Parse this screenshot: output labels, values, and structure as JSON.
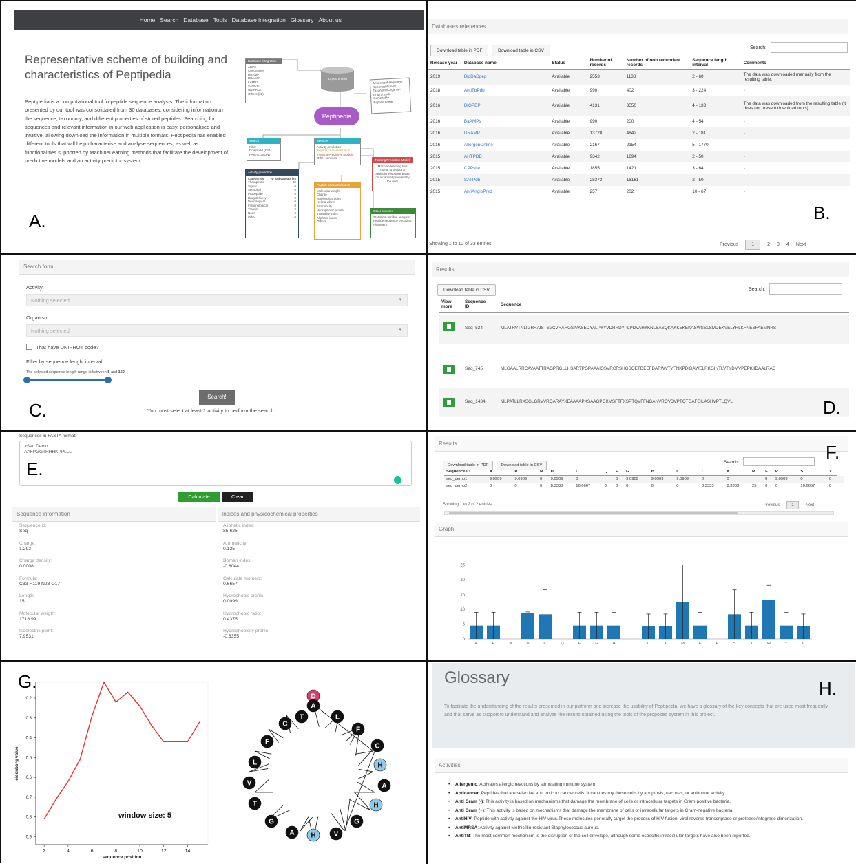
{
  "labels": {
    "a": "A.",
    "b": "B.",
    "c": "C.",
    "d": "D.",
    "e": "E.",
    "f": "F.",
    "g": "G.",
    "h": "H."
  },
  "panel_a": {
    "nav": [
      "Home",
      "Search",
      "Database",
      "Tools",
      "Database integration",
      "Glossary",
      "About us"
    ],
    "title": "Representative scheme of building and characteristics of Peptipedia",
    "text": "Peptipedia is a computational tool forpeptide sequence analysis. The information presented by our tool was consolidated from 30 databases, considering informationon the sequence, taxonomy, and different properties of stored peptides. Searching for sequences and relevant information in our web application is easy, personalised and intuitive, allowing download the information in multiple formats. Peptipedia has enabled different tools that will help characterise and analyse sequences, as well as functionalities supported by MachineLearning methods that facilitate the development of predictive models and an activity predictor system.",
    "diagram": {
      "db_integration": "Database integration",
      "db_list": [
        "ADP3",
        "ConoServer",
        "DRAMP",
        "DBAASP",
        "LAMP2",
        "SATPdb",
        "UNIPROT",
        "Others (22)"
      ],
      "center": "Peptipedia",
      "storage": "33,000 entries",
      "records": [
        "Amino acid sequence",
        "Reported Activity",
        "Taxonomy/Organism",
        "Uniprot code",
        "Genic table",
        "Peptide name"
      ],
      "search": {
        "title": "Search",
        "items": [
          "Filter",
          "Download (CSV, FASTA, JSON)"
        ]
      },
      "services": {
        "title": "Services",
        "items": [
          "Activity prediction",
          "Peptide characterization",
          "Training Predictive Models",
          "Other services"
        ]
      },
      "training": {
        "title": "Training Prediction Model",
        "text": "Machine learning tool useful to predict a particular response based on a dataset provided by the user"
      },
      "activity": {
        "title": "Activity prediction",
        "cols": [
          "Categories",
          "N° subcategories"
        ],
        "rows": [
          [
            "Therapeutic",
            "32"
          ],
          [
            "Signal",
            "0"
          ],
          [
            "Sensorial",
            "0"
          ],
          [
            "Propeptide",
            "0"
          ],
          [
            "Drug delivery",
            "0"
          ],
          [
            "Neurological",
            "0"
          ],
          [
            "Immunological",
            "0"
          ],
          [
            "Transit",
            "0"
          ],
          [
            "None",
            "0"
          ],
          [
            "Other",
            "0"
          ]
        ]
      },
      "characterization": {
        "title": "Peptide characterization",
        "items": [
          "Molecular weight",
          "Charge",
          "Isoelectrical point",
          "Helical wheel",
          "Aromaticity",
          "Hydrophobic profile",
          "Instability index",
          "Aliphatic index",
          "Others"
        ]
      },
      "other": {
        "title": "Other services",
        "items": [
          "Statistical residue analysis",
          "Peptide sequence encoding",
          "Alignment"
        ]
      }
    }
  },
  "panel_b": {
    "header": "Databases references",
    "btn_pdf": "Download table in PDF",
    "btn_csv": "Download table in CSV",
    "search_label": "Search:",
    "columns": [
      "Release year",
      "Database name",
      "Status",
      "Number of records",
      "Number of non redundant records",
      "Sequence length interval",
      "Comments"
    ],
    "rows": [
      [
        "2019",
        "BioDaDpep",
        "Available",
        "2553",
        "1138",
        "2 - 60",
        "The data was downloaded manually from the resulting table."
      ],
      [
        "2018",
        "AntiTbPdb",
        "Available",
        "990",
        "402",
        "3 - 224",
        "-"
      ],
      [
        "2016",
        "BIOPEP",
        "Available",
        "4131",
        "3550",
        "4 - 133",
        "The data was downloaded from the resulting table (it does not present download tools)"
      ],
      [
        "2016",
        "BaAMPs",
        "Available",
        "990",
        "200",
        "4 - 54",
        "-"
      ],
      [
        "2016",
        "DRAMP",
        "Available",
        "13728",
        "4842",
        "2 - 181",
        "-"
      ],
      [
        "2016",
        "AllergenOnline",
        "Available",
        "2167",
        "2154",
        "5 - 1770",
        "-"
      ],
      [
        "2015",
        "AHTPDB",
        "Available",
        "9342",
        "1694",
        "2 - 50",
        "-"
      ],
      [
        "2015",
        "CPPsite",
        "Available",
        "1855",
        "1421",
        "3 - 64",
        "-"
      ],
      [
        "2015",
        "SATPdb",
        "Available",
        "28373",
        "16161",
        "2 - 50",
        "-"
      ],
      [
        "2015",
        "AntiAngioPred",
        "Available",
        "257",
        "202",
        "10 - 67",
        "-"
      ]
    ],
    "showing": "Showing 1 to 10 of 33 entries",
    "pages": [
      "Previous",
      "1",
      "2",
      "3",
      "4",
      "Next"
    ]
  },
  "panel_c": {
    "header": "Search form",
    "activity_label": "Activity:",
    "activity_value": "Nothing selected",
    "organism_label": "Organism:",
    "organism_value": "Nothing selected",
    "checkbox_label": "That have UNIPROT code?",
    "filter_label": "Filter by sequence lenght interval:",
    "range_text_pre": "The selected sequence length range is between",
    "range_min": "5",
    "range_and": "and",
    "range_max": "150",
    "search_btn": "Search!",
    "note": "You must select at least 1 activity to perform the search"
  },
  "panel_d": {
    "header": "Results",
    "btn_csv": "Download table in CSV",
    "search_label": "Search:",
    "columns": [
      "View more",
      "Sequence ID",
      "Sequence"
    ],
    "rows": [
      [
        "Seq_524",
        "MLATRVTNLIGRRAISTSVCVRAHGSIVKSEDYALPYYVDRRDYPLPDVAHYKNLSASQKAKKEKEKASWSSLSMDEKVELYRLKFNESFAEMNRS"
      ],
      [
        "Seq_745",
        "MLGAALRRCAVAATTRAGPRGLLHSARTPGPAAAIQSVRCRSHGSQETDEEFDARWVTYFNKPDIDAWELRKGINTLVTYDMVPEPKIIDAALRAC"
      ],
      [
        "Seq_1434",
        "MLPATLLRXSGLGRVVRQARAYXEAAAAPXSAAGPGXMSFTFXSPTQVFFNGANVRQVDVPTQTGAFGILASHVPTLQVL"
      ]
    ]
  },
  "panel_e": {
    "fasta_label": "Sequences in FASTA format:",
    "fasta_text": ">Seq Demo\nAAFPGGTHHHKPPLLL",
    "btn_calc": "Calculate",
    "btn_clear": "Clear",
    "left_header": "Sequence information",
    "right_header": "Indices and physicochemical properties",
    "left": [
      [
        "Sequence id:",
        "Seq"
      ],
      [
        "Charge:",
        "1.292"
      ],
      [
        "Charge density:",
        "0.0008"
      ],
      [
        "Formula:",
        "C83 H119 N23 O17"
      ],
      [
        "Length:",
        "15"
      ],
      [
        "Molecular weigth:",
        "1718.99"
      ],
      [
        "Isoelectric point:",
        "7.9531"
      ]
    ],
    "right": [
      [
        "Aliphatic index:",
        "85.625"
      ],
      [
        "Aromaticity:",
        "0.125"
      ],
      [
        "Boman index:",
        "-0.8044"
      ],
      [
        "Calculate moment:",
        "0.6657"
      ],
      [
        "Hydrophobic profile:",
        "0.0099"
      ],
      [
        "Hydrophobic ratio:",
        "0.4375"
      ],
      [
        "Hydrophobicity profile:",
        "-0.8355"
      ]
    ]
  },
  "panel_f": {
    "header": "Results",
    "btn_pdf": "Download table in PDF",
    "btn_csv": "Download table in CSV",
    "search_label": "Search:",
    "columns": [
      "Sequence ID",
      "A",
      "R",
      "N",
      "D",
      "C",
      "Q",
      "E",
      "G",
      "H",
      "I",
      "L",
      "K",
      "M",
      "F",
      "P",
      "S",
      "T"
    ],
    "rows": [
      [
        "seq_demo1",
        "9.0909",
        "9.0909",
        "0",
        "9.0909",
        "0",
        "",
        "0",
        "9.0909",
        "9.0909",
        "9.0909",
        "0",
        "0",
        "",
        "0",
        "9.0909",
        "0",
        "0",
        ""
      ],
      [
        "seq_demo2",
        "0",
        "0",
        "0",
        "8.3333",
        "16.6667",
        "0",
        "0",
        "0",
        "0",
        "0",
        "8.3333",
        "8.3333",
        "25",
        "0",
        "0",
        "16.6667",
        "0"
      ]
    ],
    "showing": "Showing 1 to 2 of 2 entries",
    "pages": [
      "Previous",
      "1",
      "Next"
    ],
    "graph_header": "Graph"
  },
  "panel_g": {
    "window_label": "window size: 5",
    "xlabel": "sequence position",
    "ylabel": "eisenberg value",
    "wheel_labels": [
      "D",
      "A",
      "L",
      "F",
      "C",
      "H",
      "A",
      "H",
      "G",
      "V",
      "H",
      "A",
      "G",
      "T",
      "V",
      "L",
      "F",
      "C",
      "T"
    ]
  },
  "panel_h": {
    "title": "Glossary",
    "intro": "To facilitate the understanding of the results presented in our platform and increase the usability of Peptipedia, we have a glossary of the key concepts that are used most frequently and that serve as support to understand and analyze the results obtained using the tools of the proposed system in this project.",
    "section": "Activities",
    "items": [
      [
        "Allergenic",
        "Activates allergic reactions by stimulating immune system"
      ],
      [
        "Anticancer",
        "Peptides that are selective and toxic to cancer cells. It can destroy these cells by apoptosis, necrosis, or antitumor activity."
      ],
      [
        "Anti Gram (-)",
        "This activity is based on mechanisms that damage the membrane of cells or intracellular targets in Gram-positive bacteria."
      ],
      [
        "Anti Gram (+)",
        "This activity is based on mechanisms that damage the membrane of cells or intracellular targets in Gram-negative bacteria."
      ],
      [
        "AntiHIV",
        "Peptide with activity against the HIV virus.These molecules generally target the process of HIV fusion, viral reverse transcriptase or protease/integrase dimerization."
      ],
      [
        "AntiMRSA",
        "Activity against Methicillin-resistant Staphylococcus aureus."
      ],
      [
        "AntiTB",
        "The most common mechanism is the disruption of the cell envelope, although some especific intracellular targets have also been reported."
      ]
    ]
  },
  "chart_data": [
    {
      "type": "bar",
      "categories": [
        "A",
        "R",
        "N",
        "D",
        "C",
        "Q",
        "E",
        "G",
        "H",
        "I",
        "L",
        "K",
        "M",
        "F",
        "P",
        "S",
        "T",
        "W",
        "Y",
        "V"
      ],
      "values": [
        4.5,
        4.5,
        0,
        8.7,
        8.3,
        0,
        4.5,
        4.5,
        4.5,
        0,
        4.2,
        4.2,
        12.5,
        4.5,
        0,
        8.3,
        4.5,
        13.2,
        4.5,
        4.2
      ],
      "errors": [
        4.5,
        4.5,
        0,
        0.4,
        8.3,
        0,
        4.5,
        4.5,
        4.5,
        0,
        4.2,
        4.2,
        12.5,
        4.5,
        0,
        8.3,
        4.5,
        4.9,
        4.5,
        4.2
      ],
      "yticks": [
        0,
        5,
        10,
        15,
        20,
        25
      ],
      "ylim": [
        0,
        27
      ]
    },
    {
      "type": "line",
      "x": [
        2,
        3,
        4,
        5,
        6,
        7,
        8,
        9,
        10,
        11,
        12,
        13,
        14,
        15
      ],
      "y": [
        0.81,
        0.71,
        0.62,
        0.51,
        0.29,
        0.12,
        0.22,
        0.17,
        0.24,
        0.34,
        0.42,
        0.42,
        0.42,
        0.32
      ],
      "xticks": [
        2,
        4,
        6,
        8,
        10,
        12,
        14
      ],
      "yticks": [
        0.2,
        0.3,
        0.4,
        0.5,
        0.6,
        0.7,
        0.8,
        0.9
      ],
      "ylim": [
        0.94,
        0.12
      ],
      "xlim": [
        1.3,
        15.7
      ],
      "xlabel": "sequence position",
      "ylabel": "eisenberg value"
    }
  ]
}
